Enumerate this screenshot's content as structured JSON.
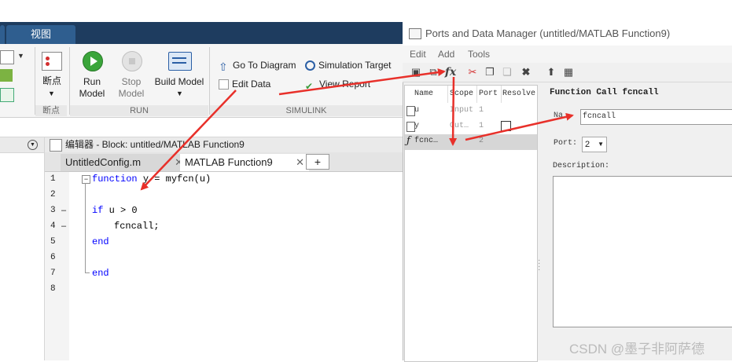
{
  "matlab": {
    "tabs": [
      {
        "label": "视图"
      }
    ],
    "toolstrip": {
      "breakpoint_label": "断点",
      "breakpoint_section": "断点",
      "run": {
        "label": "Run\nModel",
        "line1": "Run",
        "line2": "Model"
      },
      "stop": {
        "line1": "Stop",
        "line2": "Model"
      },
      "build": {
        "label": "Build Model"
      },
      "run_section": "RUN",
      "go_to_diagram": "Go To Diagram",
      "edit_data": "Edit Data",
      "simulation_target": "Simulation Target",
      "view_report": "View Report",
      "simulink_section": "SIMULINK"
    },
    "editor": {
      "title": "编辑器 - Block: untitled/MATLAB Function9",
      "tabs": [
        {
          "label": "UntitledConfig.m"
        },
        {
          "label": "MATLAB Function9"
        }
      ],
      "add_tab": "+",
      "line_numbers": [
        "1",
        "2",
        "3",
        "4",
        "5",
        "6",
        "7",
        "8"
      ],
      "dashes": [
        "",
        "",
        "–",
        "–",
        "",
        "",
        "",
        ""
      ],
      "code": {
        "line1_kw": "function",
        "line1_rest": "y = myfcn(u)",
        "line3_kw": "if",
        "line3_rest": "u > 0",
        "line4": "fcncall;",
        "line5_kw": "end",
        "line7_kw": "end"
      }
    }
  },
  "pdm": {
    "title": "Ports and Data Manager (untitled/MATLAB Function9)",
    "menu": [
      "Edit",
      "Add",
      "Tools"
    ],
    "fx_label": "fx",
    "list": {
      "headers": [
        "Name",
        "Scope",
        "Port",
        "Resolve"
      ],
      "rows": [
        {
          "name": "u",
          "scope": "Input",
          "port": "1"
        },
        {
          "name": "y",
          "scope": "Out…",
          "port": "1"
        },
        {
          "name": "fcnc…",
          "scope": "",
          "port": "2"
        }
      ]
    },
    "details": {
      "heading": "Function Call fcncall",
      "name_label": "Na",
      "name_value": "fcncall",
      "port_label": "Port:",
      "port_value": "2",
      "description_label": "Description:"
    }
  },
  "watermark": "CSDN @墨子非阿萨德",
  "colors": {
    "accent_red": "#e8302a",
    "tabstrip": "#1e3c5f",
    "keyword": "#0000ff"
  }
}
